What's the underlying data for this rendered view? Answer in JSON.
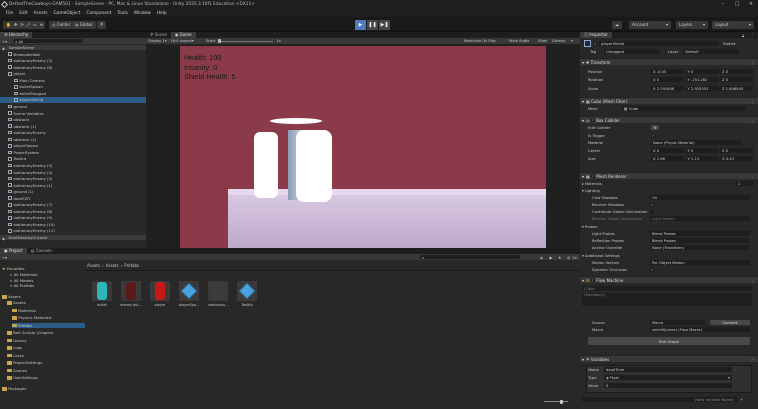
{
  "window": {
    "title": "DefeatTheCowboys-GAM501 - SampleScene - PC, Mac & Linux Standalone - Unity 2020.3.10f1 Education <DX11>"
  },
  "menu": [
    "File",
    "Edit",
    "Assets",
    "GameObject",
    "Component",
    "Tools",
    "Window",
    "Help"
  ],
  "toolbar": {
    "account_btn": "Account",
    "layers": "Layers",
    "layout": "Layout",
    "center": "Center",
    "global": "Global"
  },
  "hierarchy": {
    "tab": "Hierarchy",
    "search_label": "All",
    "rows": [
      {
        "label": "SampleScene",
        "indent": 0,
        "type": "scene"
      },
      {
        "label": "BreakableWall",
        "indent": 1,
        "type": "cube"
      },
      {
        "label": "stationaryEnemy (5)",
        "indent": 1,
        "type": "cube"
      },
      {
        "label": "stationaryEnemy (6)",
        "indent": 1,
        "type": "cube"
      },
      {
        "label": "player",
        "indent": 1,
        "type": "cube"
      },
      {
        "label": "Main Camera",
        "indent": 2,
        "type": "cube"
      },
      {
        "label": "bulletSpawn",
        "indent": 2,
        "type": "cube"
      },
      {
        "label": "bulletStopped",
        "indent": 2,
        "type": "cube"
      },
      {
        "label": "playerShield",
        "indent": 2,
        "type": "cube",
        "selected": true
      },
      {
        "label": "ground",
        "indent": 1,
        "type": "cube"
      },
      {
        "label": "Scene Variables",
        "indent": 1,
        "type": "cube"
      },
      {
        "label": "obstacle",
        "indent": 1,
        "type": "cube"
      },
      {
        "label": "obstacle (1)",
        "indent": 1,
        "type": "cube"
      },
      {
        "label": "stationaryEnemy",
        "indent": 1,
        "type": "cube"
      },
      {
        "label": "obstacle (2)",
        "indent": 1,
        "type": "cube"
      },
      {
        "label": "playerSpawn",
        "indent": 1,
        "type": "cube"
      },
      {
        "label": "PowerSystem",
        "indent": 1,
        "type": "cube"
      },
      {
        "label": "Tooltut",
        "indent": 1,
        "type": "cube"
      },
      {
        "label": "stationaryEnemy (3)",
        "indent": 1,
        "type": "cube"
      },
      {
        "label": "stationaryEnemy (4)",
        "indent": 1,
        "type": "cube"
      },
      {
        "label": "stationaryEnemy (2)",
        "indent": 1,
        "type": "cube"
      },
      {
        "label": "stationaryEnemy (1)",
        "indent": 1,
        "type": "cube"
      },
      {
        "label": "ground (1)",
        "indent": 1,
        "type": "cube"
      },
      {
        "label": "doorEXIT",
        "indent": 1,
        "type": "cube"
      },
      {
        "label": "stationaryEnemy (7)",
        "indent": 1,
        "type": "cube"
      },
      {
        "label": "stationaryEnemy (8)",
        "indent": 1,
        "type": "cube"
      },
      {
        "label": "stationaryEnemy (9)",
        "indent": 1,
        "type": "cube"
      },
      {
        "label": "stationaryEnemy (10)",
        "indent": 1,
        "type": "cube"
      },
      {
        "label": "stationaryEnemy (11)",
        "indent": 1,
        "type": "cube"
      },
      {
        "label": "DontDestroyOnLoad",
        "indent": 0,
        "type": "scene"
      }
    ]
  },
  "game": {
    "tabs": [
      "Scene",
      "Game"
    ],
    "display": "Display 1",
    "aspect": "16:9 Aspect",
    "scale_label": "Scale",
    "scale_value": "1x",
    "options": [
      "Maximize On Play",
      "Mute Audio",
      "Stats",
      "Gizmos"
    ],
    "hud": [
      "Health: 100",
      "Insanity: 0",
      "Shield Health: 5"
    ]
  },
  "project": {
    "tabs": [
      "Project",
      "Console"
    ],
    "breadcrumb": [
      "Assets",
      "Assets",
      "Prefabs"
    ],
    "count": "14",
    "favorites": {
      "label": "Favorites",
      "items": [
        "All Materials",
        "All Models",
        "All Prefabs"
      ]
    },
    "assets_root": "Assets",
    "tree": [
      {
        "label": "Assets",
        "indent": 1
      },
      {
        "label": "Materials",
        "indent": 2
      },
      {
        "label": "Physics Materials",
        "indent": 2
      },
      {
        "label": "Prefabs",
        "indent": 2,
        "selected": true
      },
      {
        "label": "Bolt Scripts (Graphs)",
        "indent": 1
      },
      {
        "label": "Library",
        "indent": 1
      },
      {
        "label": "Logs",
        "indent": 1
      },
      {
        "label": "Locks",
        "indent": 1
      },
      {
        "label": "ProjectSettings",
        "indent": 1
      },
      {
        "label": "Scenes",
        "indent": 1
      },
      {
        "label": "UserSettings",
        "indent": 1
      }
    ],
    "packages": "Packages",
    "assets": [
      {
        "label": "bullet",
        "kind": "capsule",
        "color": "#2fb7b7"
      },
      {
        "label": "enemy bul...",
        "kind": "capsule",
        "color": "#5a1a1a"
      },
      {
        "label": "player",
        "kind": "capsule",
        "color": "#c81818"
      },
      {
        "label": "playerSpa...",
        "kind": "cube",
        "color": "#4aa3de"
      },
      {
        "label": "stationary...",
        "kind": "capsule",
        "color": "#3c3c3c"
      },
      {
        "label": "Tooltut",
        "kind": "cube",
        "color": "#4aa3de"
      }
    ]
  },
  "inspector": {
    "tab": "Inspector",
    "object_name": "playerShield",
    "static_label": "Static",
    "tag_label": "Tag",
    "tag_value": "Untagged",
    "layer_label": "Layer",
    "layer_value": "Default",
    "transform": {
      "title": "Transform",
      "position": {
        "label": "Position",
        "x": "X  -0.05",
        "y": "Y  0",
        "z": "Z  0"
      },
      "rotation": {
        "label": "Rotation",
        "x": "X  0",
        "y": "Y  -151.282",
        "z": "Z  0"
      },
      "scale": {
        "label": "Scale",
        "x": "X  2.292648",
        "y": "Y  2.925353",
        "z": "Z  1.846845"
      }
    },
    "mesh_filter": {
      "title": "Cube (Mesh Filter)",
      "mesh_label": "Mesh",
      "mesh_value": "Cube"
    },
    "box_collider": {
      "title": "Box Collider",
      "edit_label": "Edit Collider",
      "trigger_label": "Is Trigger",
      "material_label": "Material",
      "material_value": "None (Physic Material)",
      "center": {
        "label": "Center",
        "x": "X  0",
        "y": "Y  0",
        "z": "Z  0"
      },
      "size": {
        "label": "Size",
        "x": "X  1.66",
        "y": "Y  1.13",
        "z": "Z  4.43"
      }
    },
    "mesh_renderer": {
      "title": "Mesh Renderer",
      "materials_label": "Materials",
      "materials_count": "1",
      "lighting_label": "Lighting",
      "cast_label": "Cast Shadows",
      "cast_value": "On",
      "receive_label": "Receive Shadows",
      "contribute_label": "Contribute Global Illumination",
      "receive_gi_label": "Receive Global Illumination",
      "receive_gi_value": "Light Probes",
      "probes_label": "Probes",
      "light_probes_label": "Light Probes",
      "light_probes_value": "Blend Probes",
      "reflection_label": "Reflection Probes",
      "reflection_value": "Blend Probes",
      "anchor_label": "Anchor Override",
      "anchor_value": "None (Transform)",
      "additional_label": "Additional Settings",
      "motion_label": "Motion Vectors",
      "motion_value": "Per Object Motion",
      "dynamic_label": "Dynamic Occlusion"
    },
    "flow_machine": {
      "title": "Flow Machine",
      "title_field": "(Title)",
      "summary_field": "(Summary)",
      "source_label": "Source",
      "source_value": "Macro",
      "convert_btn": "Convert",
      "macro_label": "Macro",
      "macro_value": "shieldSpinner (Flow Macro)",
      "edit_graph_btn": "Edit Graph"
    },
    "variables": {
      "title": "Variables",
      "name_label": "Name",
      "name_value": "deadTime",
      "type_label": "Type",
      "type_value": "Float",
      "value_label": "Value",
      "value_value": "0",
      "new_placeholder": "(New Variable Name)"
    }
  }
}
